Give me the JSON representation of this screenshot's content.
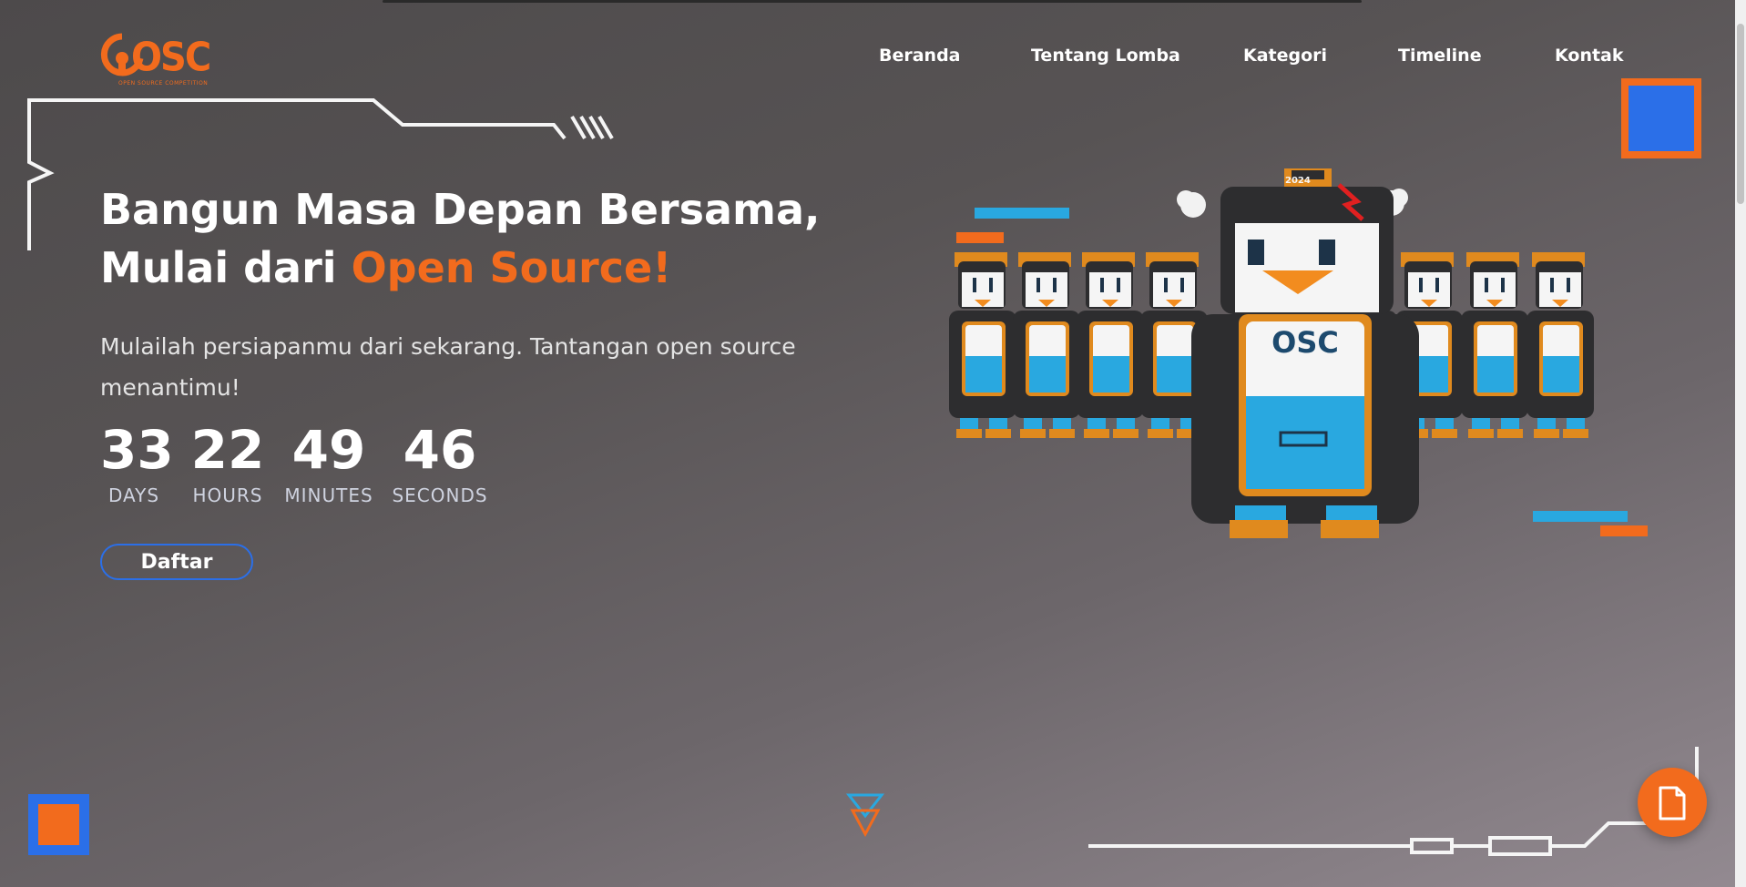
{
  "logo": {
    "text": "OSC",
    "subtitle": "OPEN SOURCE COMPETITION",
    "icon": "osc-logo"
  },
  "nav": {
    "items": [
      {
        "label": "Beranda"
      },
      {
        "label": "Tentang Lomba"
      },
      {
        "label": "Kategori"
      },
      {
        "label": "Timeline"
      },
      {
        "label": "Kontak"
      }
    ]
  },
  "hero": {
    "title_line1": "Bangun Masa Depan Bersama,",
    "title_line2_prefix": "Mulai dari ",
    "title_line2_accent": "Open Source!",
    "subtitle": "Mulailah persiapanmu dari sekarang. Tantangan open source menantimu!",
    "cta_label": "Daftar"
  },
  "countdown": {
    "days": "33",
    "days_label": "DAYS",
    "hours": "22",
    "hours_label": "HOURS",
    "minutes": "49",
    "minutes_label": "MINUTES",
    "seconds": "46",
    "seconds_label": "SECONDS"
  },
  "mascot": {
    "badge_text": "OSC",
    "hat_text": "2024",
    "icon": "penguin-mascot"
  },
  "fab": {
    "icon": "document-icon"
  },
  "colors": {
    "accent": "#f26b1d",
    "blue": "#2b6fe8",
    "cyan": "#29a8e0"
  }
}
